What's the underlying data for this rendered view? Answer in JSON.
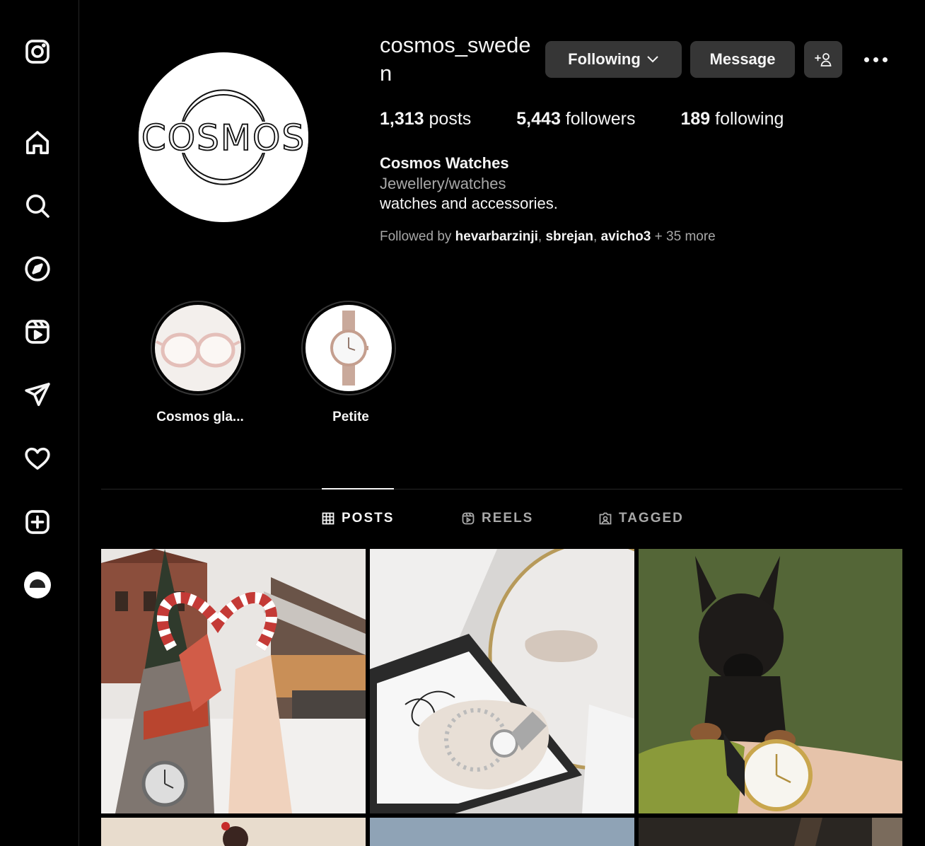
{
  "sidebar": {
    "items": [
      {
        "name": "instagram-logo-icon"
      },
      {
        "name": "home-icon"
      },
      {
        "name": "search-icon"
      },
      {
        "name": "explore-icon"
      },
      {
        "name": "reels-icon"
      },
      {
        "name": "messages-icon"
      },
      {
        "name": "notifications-icon"
      },
      {
        "name": "create-icon"
      },
      {
        "name": "profile-avatar-icon"
      }
    ]
  },
  "profile": {
    "username": "cosmos_sweden",
    "avatar_text": "COSMOS",
    "following_label": "Following",
    "message_label": "Message",
    "stats": {
      "posts_count": "1,313",
      "posts_label": "posts",
      "followers_count": "5,443",
      "followers_label": "followers",
      "following_count": "189",
      "following_label": "following"
    },
    "full_name": "Cosmos Watches",
    "category": "Jewellery/watches",
    "bio": "watches and accessories.",
    "followed_by_prefix": "Followed by",
    "followed_by_names": [
      "hevarbarzinji",
      "sbrejan",
      "avicho3"
    ],
    "followed_by_more": "+ 35 more"
  },
  "highlights": [
    {
      "label": "Cosmos gla..."
    },
    {
      "label": "Petite"
    }
  ],
  "tabs": [
    {
      "label": "POSTS",
      "active": true
    },
    {
      "label": "REELS",
      "active": false
    },
    {
      "label": "TAGGED",
      "active": false
    }
  ],
  "colors": {
    "background": "#000000",
    "text": "#f5f5f5",
    "secondary_text": "#a8a8a8",
    "button_bg": "#363636",
    "divider": "#262626"
  }
}
